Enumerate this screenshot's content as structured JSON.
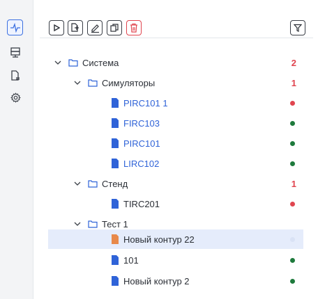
{
  "rail": {
    "items": [
      {
        "name": "activity-icon",
        "active": true
      },
      {
        "name": "server-icon",
        "active": false
      },
      {
        "name": "file-export-icon",
        "active": false
      },
      {
        "name": "gear-icon",
        "active": false
      }
    ]
  },
  "toolbar": {
    "buttons": [
      "play-icon",
      "add-file-icon",
      "edit-icon",
      "copy-icon",
      "delete-icon"
    ],
    "filter_icon": "filter-icon"
  },
  "tree": {
    "sistema": {
      "label": "Система",
      "count": "2"
    },
    "simulyatory": {
      "label": "Симуляторы",
      "count": "1"
    },
    "pirc101_1": {
      "label": "PIRC101 1",
      "status": "error"
    },
    "firc103": {
      "label": "FIRC103",
      "status": "ok"
    },
    "pirc101": {
      "label": "PIRC101",
      "status": "ok"
    },
    "lirc102": {
      "label": "LIRC102",
      "status": "ok"
    },
    "stend": {
      "label": "Стенд",
      "count": "1"
    },
    "tirc201": {
      "label": "TIRC201",
      "status": "error"
    },
    "test1": {
      "label": "Тест 1"
    },
    "novyi22": {
      "label": "Новый контур 22",
      "status": "none"
    },
    "r101": {
      "label": "101",
      "status": "ok"
    },
    "novyi2": {
      "label": "Новый контур 2",
      "status": "ok"
    }
  },
  "colors": {
    "accent": "#3b6fe0",
    "link": "#2f63d8",
    "error": "#e0454f",
    "ok": "#1e7a3c",
    "selected_bg": "#e5ecfb",
    "file_orange": "#e8894a"
  }
}
